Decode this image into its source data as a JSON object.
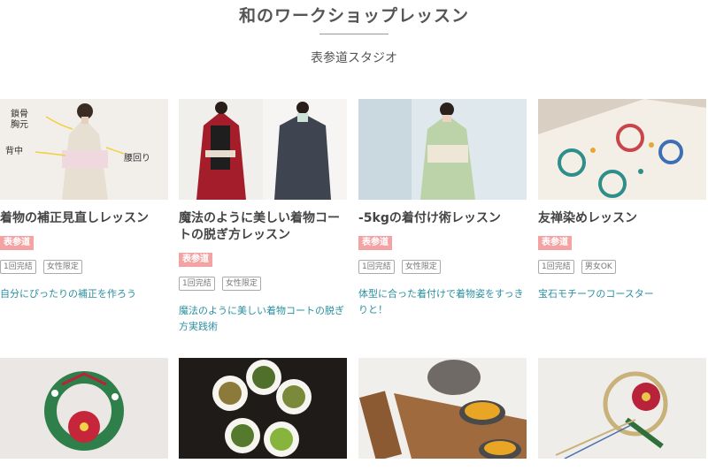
{
  "page": {
    "title": "和のワークショップレッスン",
    "subtitle": "表参道スタジオ"
  },
  "cards": [
    {
      "title": "着物の補正見直しレッスン",
      "location": "表参道",
      "tags": [
        "1回完結",
        "女性限定"
      ],
      "description": "自分にぴったりの補正を作ろう",
      "image_labels": [
        "鎖骨",
        "胸元",
        "背中",
        "腰回り"
      ]
    },
    {
      "title": "魔法のように美しい着物コートの脱ぎ方レッスン",
      "location": "表参道",
      "tags": [
        "1回完結",
        "女性限定"
      ],
      "description": "魔法のように美しい着物コートの脱ぎ方実践術"
    },
    {
      "title": "-5kgの着付け術レッスン",
      "location": "表参道",
      "tags": [
        "1回完結",
        "女性限定"
      ],
      "description": "体型に合った着付けで着物姿をすっきりと！"
    },
    {
      "title": "友禅染めレッスン",
      "location": "表参道",
      "tags": [
        "1回完結",
        "男女OK"
      ],
      "description": "宝石モチーフのコースター"
    }
  ]
}
